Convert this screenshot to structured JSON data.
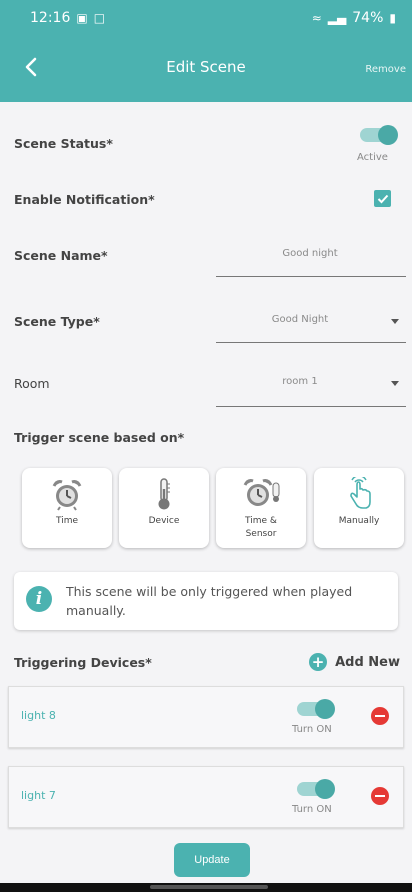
{
  "status_bar": {
    "time": "12:16",
    "right_text": "74%",
    "icons": [
      "gallery-icon",
      "screenshot-icon",
      "wifi-icon",
      "signal-icon",
      "battery-icon"
    ]
  },
  "header": {
    "title": "Edit Scene",
    "remove_label": "Remove",
    "back_icon": "chevron-left-icon"
  },
  "form": {
    "scene_status": {
      "label": "Scene Status*",
      "toggle_caption": "Active",
      "on": true
    },
    "enable_notification": {
      "label": "Enable Notification*",
      "checked": true
    },
    "scene_name": {
      "label": "Scene Name*",
      "value": "Good night"
    },
    "scene_type": {
      "label": "Scene Type*",
      "value": "Good Night"
    },
    "room": {
      "label": "Room",
      "value": "room 1"
    }
  },
  "trigger": {
    "label": "Trigger scene based on*",
    "options": [
      {
        "label": "Time",
        "icon": "alarm-clock-icon"
      },
      {
        "label": "Device",
        "icon": "thermometer-icon"
      },
      {
        "label": "Time & Sensor",
        "icon": "alarm-sensor-icon"
      },
      {
        "label": "Manually",
        "icon": "hand-tap-icon"
      }
    ]
  },
  "info": {
    "text": "This scene will be only triggered when played manually."
  },
  "triggering_devices": {
    "label": "Triggering Devices*",
    "add_new_label": "Add New",
    "items": [
      {
        "name": "light 8",
        "toggle_caption": "Turn ON",
        "on": true
      },
      {
        "name": "light 7",
        "toggle_caption": "Turn ON",
        "on": true
      }
    ]
  },
  "footer": {
    "update_label": "Update"
  },
  "colors": {
    "accent": "#4bb2b0",
    "danger": "#e53935",
    "background": "#f4f4f6"
  }
}
